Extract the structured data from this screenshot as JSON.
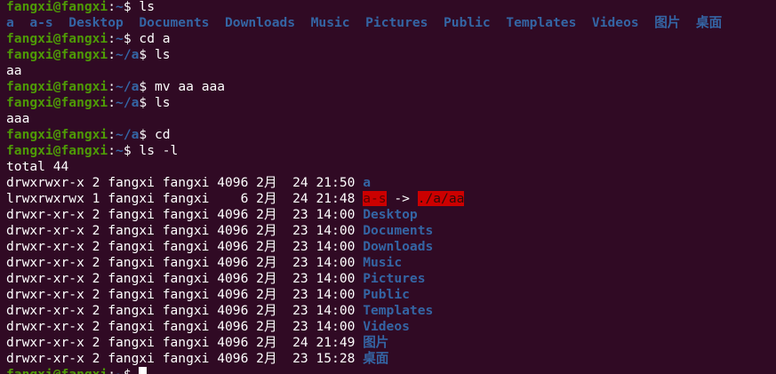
{
  "prompt": {
    "user_host": "fangxi@fangxi",
    "colon": ":",
    "dollar": "$"
  },
  "lines": [
    {
      "type": "cmd",
      "path": "~",
      "cmd": " ls"
    },
    {
      "type": "ls",
      "items": [
        "a",
        "a-s",
        "Desktop",
        "Documents",
        "Downloads",
        "Music",
        "Pictures",
        "Public",
        "Templates",
        "Videos",
        "图片",
        "桌面"
      ]
    },
    {
      "type": "cmd",
      "path": "~",
      "cmd": " cd a"
    },
    {
      "type": "cmd",
      "path": "~/a",
      "cmd": " ls"
    },
    {
      "type": "text",
      "text": "aa"
    },
    {
      "type": "cmd",
      "path": "~/a",
      "cmd": " mv aa aaa"
    },
    {
      "type": "cmd",
      "path": "~/a",
      "cmd": " ls"
    },
    {
      "type": "text",
      "text": "aaa"
    },
    {
      "type": "cmd",
      "path": "~/a",
      "cmd": " cd"
    },
    {
      "type": "cmd",
      "path": "~",
      "cmd": " ls -l"
    },
    {
      "type": "text",
      "text": "total 44"
    },
    {
      "type": "long",
      "meta": "drwxrwxr-x 2 fangxi fangxi 4096 2月  24 21:50 ",
      "name": "a",
      "kind": "dir"
    },
    {
      "type": "long",
      "meta": "lrwxrwxrwx 1 fangxi fangxi    6 2月  24 21:48 ",
      "name": "a-s",
      "kind": "broken",
      "arrow": " -> ",
      "target": "./a/aa"
    },
    {
      "type": "long",
      "meta": "drwxr-xr-x 2 fangxi fangxi 4096 2月  23 14:00 ",
      "name": "Desktop",
      "kind": "dir"
    },
    {
      "type": "long",
      "meta": "drwxr-xr-x 2 fangxi fangxi 4096 2月  23 14:00 ",
      "name": "Documents",
      "kind": "dir"
    },
    {
      "type": "long",
      "meta": "drwxr-xr-x 2 fangxi fangxi 4096 2月  23 14:00 ",
      "name": "Downloads",
      "kind": "dir"
    },
    {
      "type": "long",
      "meta": "drwxr-xr-x 2 fangxi fangxi 4096 2月  23 14:00 ",
      "name": "Music",
      "kind": "dir"
    },
    {
      "type": "long",
      "meta": "drwxr-xr-x 2 fangxi fangxi 4096 2月  23 14:00 ",
      "name": "Pictures",
      "kind": "dir"
    },
    {
      "type": "long",
      "meta": "drwxr-xr-x 2 fangxi fangxi 4096 2月  23 14:00 ",
      "name": "Public",
      "kind": "dir"
    },
    {
      "type": "long",
      "meta": "drwxr-xr-x 2 fangxi fangxi 4096 2月  23 14:00 ",
      "name": "Templates",
      "kind": "dir"
    },
    {
      "type": "long",
      "meta": "drwxr-xr-x 2 fangxi fangxi 4096 2月  23 14:00 ",
      "name": "Videos",
      "kind": "dir"
    },
    {
      "type": "long",
      "meta": "drwxr-xr-x 2 fangxi fangxi 4096 2月  24 21:49 ",
      "name": "图片",
      "kind": "dir"
    },
    {
      "type": "long",
      "meta": "drwxr-xr-x 2 fangxi fangxi 4096 2月  23 15:28 ",
      "name": "桌面",
      "kind": "dir"
    },
    {
      "type": "cmd",
      "path": "~",
      "cmd": " ",
      "cursor": true
    }
  ],
  "colors": {
    "background": "#300a24",
    "prompt_user": "#4e9a06",
    "prompt_path": "#3465a4",
    "directory": "#3465a4",
    "broken_link_bg": "#cc0000",
    "text": "#ffffff"
  }
}
